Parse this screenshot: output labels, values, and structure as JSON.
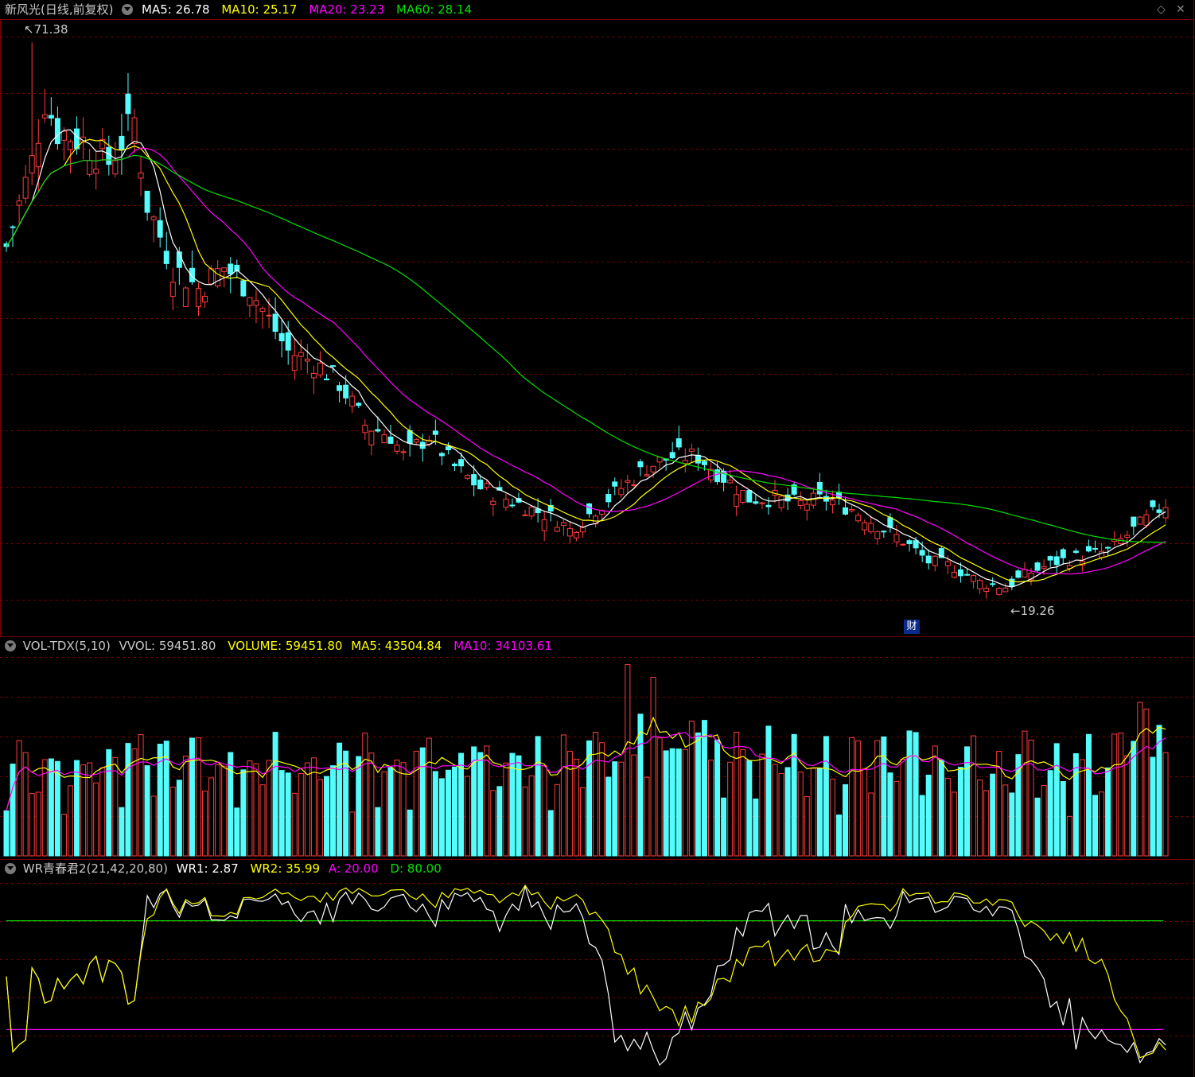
{
  "main_header": {
    "title": "新风光(日线,前复权)",
    "ma5": "MA5: 26.78",
    "ma10": "MA10: 25.17",
    "ma20": "MA20: 23.23",
    "ma60": "MA60: 28.14"
  },
  "vol_header": {
    "name": "VOL-TDX(5,10)",
    "vvol": "VVOL: 59451.80",
    "volume": "VOLUME: 59451.80",
    "ma5": "MA5: 43504.84",
    "ma10": "MA10: 34103.61"
  },
  "wr_header": {
    "name": "WR青春君2(21,42,20,80)",
    "wr1": "WR1: 2.87",
    "wr2": "WR2: 35.99",
    "a": "A: 20.00",
    "d": "D: 80.00"
  },
  "annotations": {
    "high_label": "71.38",
    "low_label": "19.26",
    "finance_badge": "财"
  },
  "icons": [
    "settings-dropdown-icon",
    "diamond-icon",
    "close-icon"
  ],
  "colors": {
    "up": "#ff3c3c",
    "down": "#54fcfc",
    "ma5": "#ffffff",
    "ma10": "#ffff00",
    "ma20": "#ff00ff",
    "ma60": "#00e000",
    "grid": "#7a0000",
    "wr1": "#ffffff",
    "wr2": "#ffff00",
    "line_a": "#00e000",
    "line_d": "#ff00ff"
  },
  "chart_data": [
    {
      "type": "candlestick",
      "high": 71.38,
      "low": 19.26,
      "ma_last": {
        "MA5": 26.78,
        "MA10": 25.17,
        "MA20": 23.23,
        "MA60": 28.14
      }
    },
    {
      "type": "bar",
      "last": {
        "VVOL": 59451.8,
        "VOLUME": 59451.8,
        "MA5": 43504.84,
        "MA10": 34103.61
      }
    },
    {
      "type": "line",
      "last": {
        "WR1": 2.87,
        "WR2": 35.99
      },
      "levels": {
        "A": 20.0,
        "D": 80.0
      }
    }
  ]
}
